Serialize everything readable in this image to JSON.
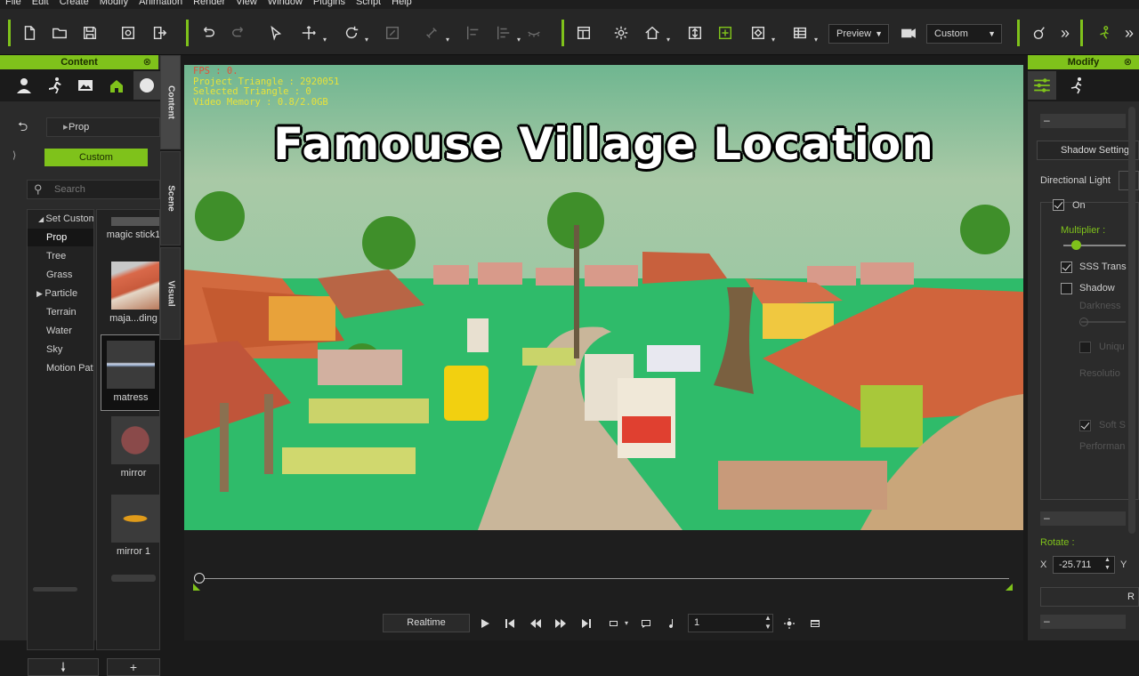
{
  "menu": [
    "File",
    "Edit",
    "Create",
    "Modify",
    "Animation",
    "Render",
    "View",
    "Window",
    "Plugins",
    "Script",
    "Help"
  ],
  "toolbar": {
    "preview_label": "Preview",
    "custom_label": "Custom",
    "more": "»"
  },
  "content_panel": {
    "title": "Content",
    "close": "⊗",
    "breadcrumb": "Prop",
    "custom_button": "Custom",
    "search_placeholder": "Search",
    "tree_root": "Set Custom",
    "tree_items": [
      "Prop",
      "Tree",
      "Grass",
      "Particle",
      "Terrain",
      "Water",
      "Sky",
      "Motion Path"
    ],
    "thumbnails": [
      "magic stick1",
      "maja...ding",
      "matress",
      "mirror",
      "mirror 1"
    ],
    "side_tabs": [
      "Content",
      "Scene",
      "Visual"
    ]
  },
  "viewport": {
    "hud": {
      "fps": "FPS : 0.",
      "project_triangle": "Project Triangle : 2920051",
      "selected_triangle": "Selected Triangle : 0",
      "video_memory": "Video Memory : 0.8/2.0GB"
    },
    "overlay_title": "Famouse Village Location"
  },
  "timeline": {
    "realtime_label": "Realtime",
    "frame_value": "1"
  },
  "modify_panel": {
    "title": "Modify",
    "close": "⊗",
    "collapse": "–",
    "shadow_settings": "Shadow Setting",
    "light_type": "Directional Light",
    "on_label": "On",
    "multiplier_label": "Multiplier :",
    "multiplier_level": 0.2,
    "sss_label": "SSS Trans",
    "shadow_label": "Shadow",
    "darkness_label": "Darkness",
    "unique_label": "Uniqu",
    "resolution_label": "Resolutio",
    "soft_label": "Soft S",
    "performance_label": "Performan",
    "rotate_label": "Rotate :",
    "x_label": "X",
    "x_value": "-25.711",
    "y_label": "Y",
    "reset_label": "R"
  },
  "colors": {
    "accent": "#7fc21b",
    "hud_red": "#e0523a",
    "hud_yellow": "#e8e23a"
  }
}
